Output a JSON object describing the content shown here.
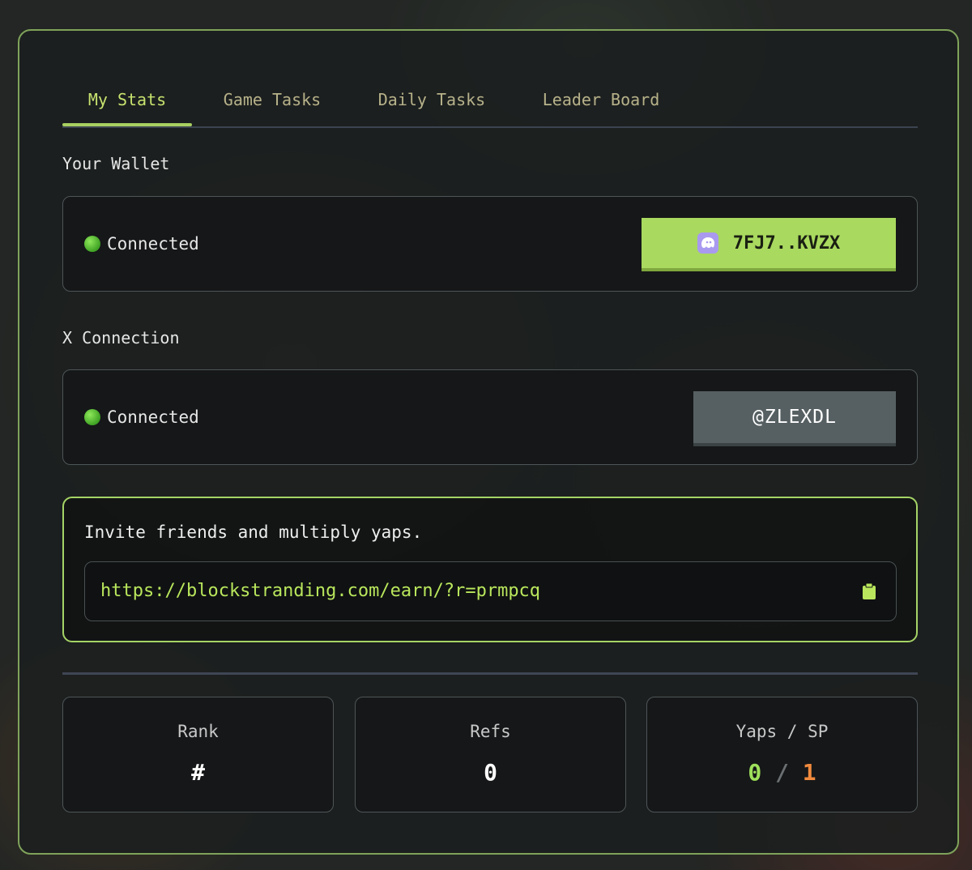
{
  "tabs": [
    {
      "label": "My Stats",
      "active": true
    },
    {
      "label": "Game Tasks",
      "active": false
    },
    {
      "label": "Daily Tasks",
      "active": false
    },
    {
      "label": "Leader Board",
      "active": false
    }
  ],
  "wallet": {
    "section_label": "Your Wallet",
    "status": "Connected",
    "address_label": "7FJ7..KVZX",
    "wallet_icon": "phantom-ghost-icon"
  },
  "x_connection": {
    "section_label": "X Connection",
    "status": "Connected",
    "handle": "@ZLEXDL"
  },
  "invite": {
    "text": "Invite friends and multiply yaps.",
    "link": "https://blockstranding.com/earn/?r=prmpcq",
    "copy_icon": "clipboard-icon"
  },
  "stats": {
    "rank": {
      "label": "Rank",
      "value": "#"
    },
    "refs": {
      "label": "Refs",
      "value": "0"
    },
    "yaps_sp": {
      "label": "Yaps / SP",
      "yaps": "0",
      "separator": "/",
      "sp": "1"
    }
  },
  "colors": {
    "accent": "#a9d95f",
    "panel_border": "#7fa35a",
    "sp": "#f08a3e"
  }
}
